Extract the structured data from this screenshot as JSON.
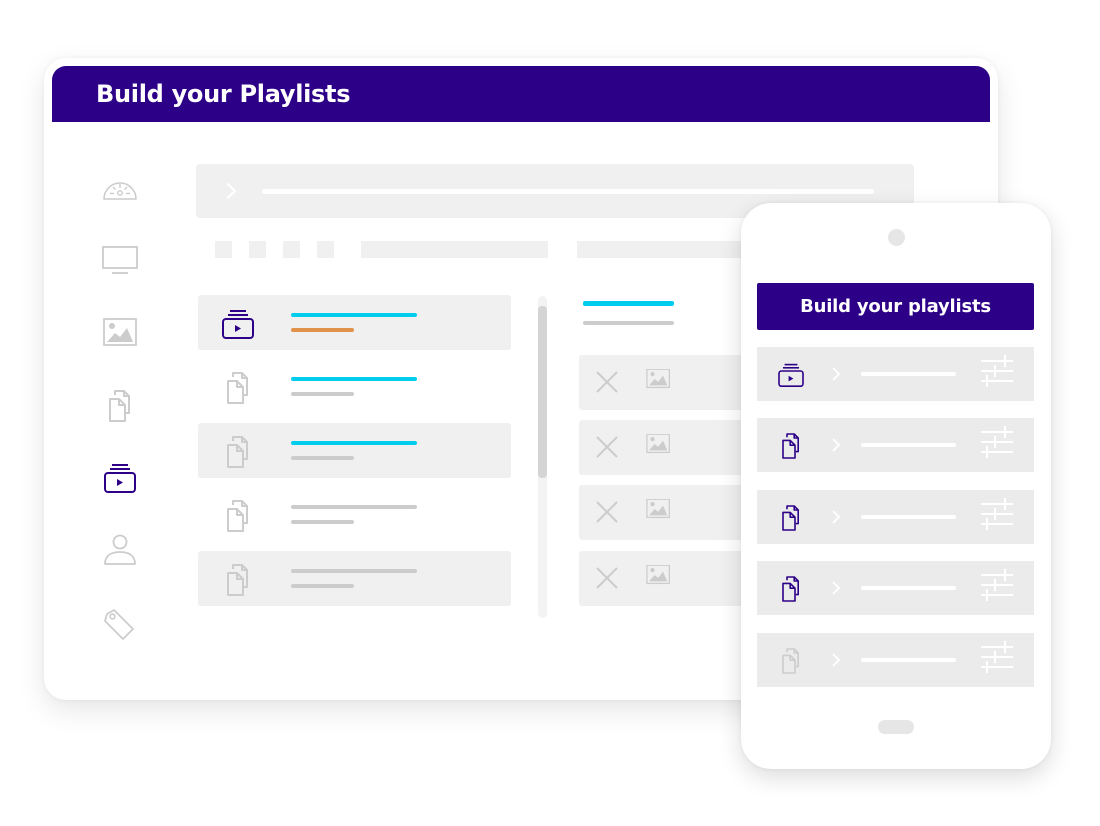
{
  "colors": {
    "brand": "#2c0087",
    "accent_cyan": "#00ccee",
    "accent_orange": "#e0914a",
    "placeholder_gray": "#cccccc",
    "panel_gray": "#f0f0f0",
    "icon_gray": "#cccccc"
  },
  "desktop": {
    "title": "Build your Playlists",
    "sidebar": {
      "items": [
        {
          "icon": "dashboard-gauge-icon",
          "active": false
        },
        {
          "icon": "monitor-icon",
          "active": false
        },
        {
          "icon": "image-icon",
          "active": false
        },
        {
          "icon": "documents-icon",
          "active": false
        },
        {
          "icon": "playlist-icon",
          "active": true
        },
        {
          "icon": "user-icon",
          "active": false
        },
        {
          "icon": "tag-icon",
          "active": false
        }
      ]
    },
    "search": {
      "icon": "chevron-right-icon"
    },
    "list": {
      "items": [
        {
          "icon": "playlist-icon",
          "active": true,
          "shaded": true,
          "line1": "cyan",
          "line2": "orange"
        },
        {
          "icon": "documents-icon",
          "active": false,
          "shaded": false,
          "line1": "cyan",
          "line2": "gray"
        },
        {
          "icon": "documents-icon",
          "active": false,
          "shaded": true,
          "line1": "cyan",
          "line2": "gray"
        },
        {
          "icon": "documents-icon",
          "active": false,
          "shaded": false,
          "line1": "gray",
          "line2": "gray"
        },
        {
          "icon": "documents-icon",
          "active": false,
          "shaded": true,
          "line1": "gray",
          "line2": "gray"
        }
      ]
    },
    "right_panel": {
      "cards": [
        {
          "remove_icon": "close-icon",
          "thumb_icon": "image-icon"
        },
        {
          "remove_icon": "close-icon",
          "thumb_icon": "image-icon"
        },
        {
          "remove_icon": "close-icon",
          "thumb_icon": "image-icon"
        },
        {
          "remove_icon": "close-icon",
          "thumb_icon": "image-icon"
        }
      ]
    }
  },
  "phone": {
    "title": "Build your playlists",
    "rows": [
      {
        "icon": "playlist-icon",
        "active": true
      },
      {
        "icon": "documents-icon",
        "active": true
      },
      {
        "icon": "documents-icon",
        "active": true
      },
      {
        "icon": "documents-icon",
        "active": true
      },
      {
        "icon": "documents-icon",
        "active": false
      }
    ]
  }
}
